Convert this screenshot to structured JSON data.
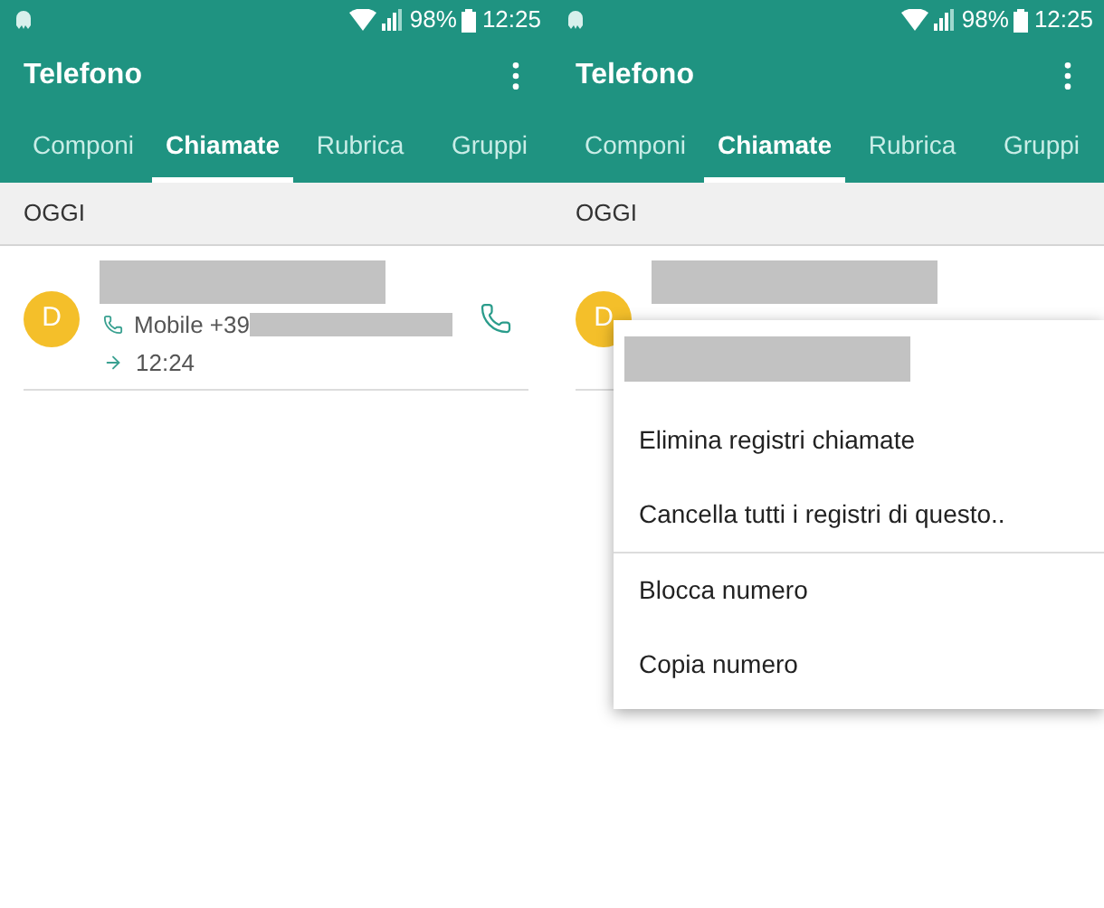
{
  "screens": [
    {
      "status_bar": {
        "battery": "98%",
        "time": "12:25"
      },
      "title": "Telefono",
      "tabs": [
        {
          "label": "Componi",
          "selected": false
        },
        {
          "label": "Chiamate",
          "selected": true
        },
        {
          "label": "Rubrica",
          "selected": false
        },
        {
          "label": "Gruppi",
          "selected": false
        }
      ],
      "section": "OGGI",
      "calls": [
        {
          "initial": "D",
          "number_label": "Mobile +39",
          "time": "12:24"
        }
      ]
    },
    {
      "status_bar": {
        "battery": "98%",
        "time": "12:25"
      },
      "title": "Telefono",
      "tabs": [
        {
          "label": "Componi",
          "selected": false
        },
        {
          "label": "Chiamate",
          "selected": true
        },
        {
          "label": "Rubrica",
          "selected": false
        },
        {
          "label": "Gruppi",
          "selected": false
        }
      ],
      "section": "OGGI",
      "calls": [
        {
          "initial": "D"
        }
      ],
      "menu": {
        "groups": [
          [
            "Elimina registri chiamate",
            "Cancella tutti i registri di questo.."
          ],
          [
            "Blocca numero",
            "Copia numero"
          ]
        ]
      }
    }
  ]
}
